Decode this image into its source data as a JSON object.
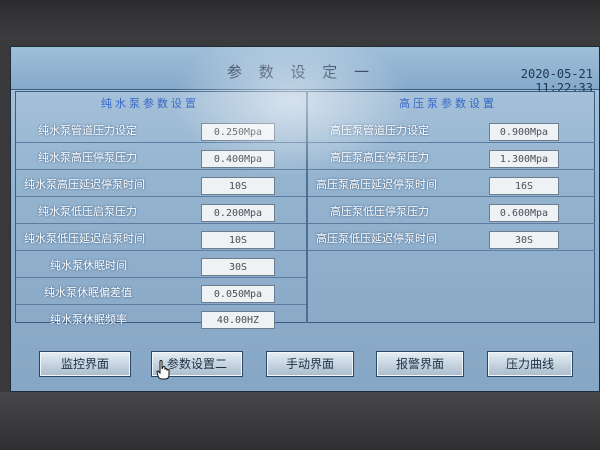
{
  "header": {
    "title": "参 数 设 定 一",
    "date": "2020-05-21",
    "time": "11:22:33"
  },
  "left_section": {
    "heading": "纯水泵参数设置",
    "rows": [
      {
        "label": "纯水泵管道压力设定",
        "value": "0.250Mpa"
      },
      {
        "label": "纯水泵高压停泵压力",
        "value": "0.400Mpa"
      },
      {
        "label": "纯水泵高压延迟停泵时间",
        "value": "10S"
      },
      {
        "label": "纯水泵低压启泵压力",
        "value": "0.200Mpa"
      },
      {
        "label": "纯水泵低压延迟启泵时间",
        "value": "10S"
      },
      {
        "label": "纯水泵休眠时间",
        "value": "30S"
      },
      {
        "label": "纯水泵休眠偏差值",
        "value": "0.050Mpa"
      },
      {
        "label": "纯水泵休眠频率",
        "value": "40.00HZ"
      }
    ]
  },
  "right_section": {
    "heading": "高压泵参数设置",
    "rows": [
      {
        "label": "高压泵管道压力设定",
        "value": "0.900Mpa"
      },
      {
        "label": "高压泵高压停泵压力",
        "value": "1.300Mpa"
      },
      {
        "label": "高压泵高压延迟停泵时间",
        "value": "16S"
      },
      {
        "label": "高压泵低压停泵压力",
        "value": "0.600Mpa"
      },
      {
        "label": "高压泵低压延迟停泵时间",
        "value": "30S"
      }
    ]
  },
  "nav": {
    "monitor": "监控界面",
    "params2": "参数设置二",
    "manual": "手动界面",
    "alarm": "报警界面",
    "pressure_curve": "压力曲线"
  }
}
